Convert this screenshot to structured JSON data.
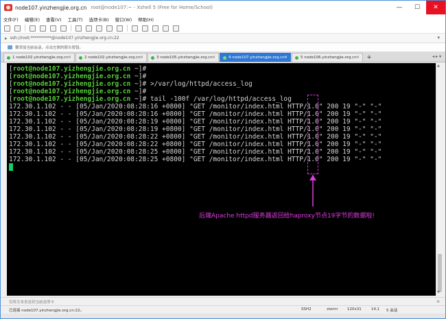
{
  "window": {
    "title_main": "node107.yinzhengjie.org.cn",
    "title_sub": "root@node107:~ - Xshell 5 (Free for Home/School)",
    "controls": [
      "—",
      "☐",
      "✕"
    ]
  },
  "menu": {
    "items": [
      "文件(F)",
      "编辑(E)",
      "查看(V)",
      "工具(T)",
      "选项卡(B)",
      "窗口(W)",
      "帮助(H)"
    ]
  },
  "address": {
    "text": "ssh://root:**********@node107.yinzhengjie.org.cn:22"
  },
  "hint": {
    "text": "要添加当前会话，点击左侧的箭头按钮。"
  },
  "tabs": [
    {
      "label": "1 node102.yinzhengjie.org.cn",
      "active": false
    },
    {
      "label": "2 node102.yinzhengjie.org.cn",
      "active": false
    },
    {
      "label": "3 node105.yinzhengjie.org.cn",
      "active": false
    },
    {
      "label": "4 node107.yinzhengjie.org.cn",
      "active": true
    },
    {
      "label": "5 node106.yinzhengjie.org.cn",
      "active": false
    }
  ],
  "terminal": {
    "prompt_user": "root@node107.yizhengjie.org.cn",
    "prompt_path": " ~",
    "commands": [
      "",
      "",
      ">/var/log/httpd/access_log",
      "",
      "tail -100f /var/log/httpd/access_log"
    ],
    "log_lines": [
      "172.30.1.102 - - [05/Jan/2020:08:28:16 +0800] \"GET /monitor/index.html HTTP/1.0\" 200 19 \"-\" \"-\"",
      "172.30.1.102 - - [05/Jan/2020:08:28:16 +0800] \"GET /monitor/index.html HTTP/1.0\" 200 19 \"-\" \"-\"",
      "172.30.1.102 - - [05/Jan/2020:08:28:19 +0800] \"GET /monitor/index.html HTTP/1.0\" 200 19 \"-\" \"-\"",
      "172.30.1.102 - - [05/Jan/2020:08:28:19 +0800] \"GET /monitor/index.html HTTP/1.0\" 200 19 \"-\" \"-\"",
      "172.30.1.102 - - [05/Jan/2020:08:28:22 +0800] \"GET /monitor/index.html HTTP/1.0\" 200 19 \"-\" \"-\"",
      "172.30.1.102 - - [05/Jan/2020:08:28:22 +0800] \"GET /monitor/index.html HTTP/1.0\" 200 19 \"-\" \"-\"",
      "172.30.1.102 - - [05/Jan/2020:08:28:25 +0800] \"GET /monitor/index.html HTTP/1.0\" 200 19 \"-\" \"-\"",
      "172.30.1.102 - - [05/Jan/2020:08:28:25 +0800] \"GET /monitor/index.html HTTP/1.0\" 200 19 \"-\" \"-\""
    ]
  },
  "annotation": {
    "text": "后端Apache httpd服务器返回给haproxy节点19字节的数据啦!",
    "color": "#e13be5"
  },
  "inputbar": {
    "text": "仅将文本发送到当前选项卡"
  },
  "status": {
    "connection": "已连接 node107.yinzhengjie.org.cn:22。",
    "protocol": "SSH2",
    "term_type": "xterm",
    "size": "120x31",
    "cursor_pos": "14,1",
    "sessions": "5 会话"
  },
  "colors": {
    "terminal_bg": "#000000",
    "prompt_green": "#57d13a",
    "active_tab": "#2f78d6",
    "cursor": "#0fd16a",
    "close_button": "#e81123"
  }
}
